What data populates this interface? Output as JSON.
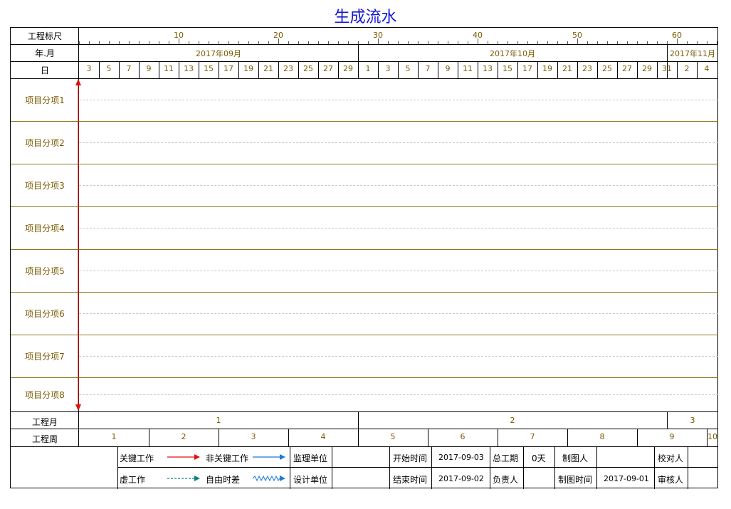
{
  "title": "生成流水",
  "header": {
    "scale_label": "工程标尺",
    "month_label": "年.月",
    "day_label": "日",
    "scale_ticks": [
      "10",
      "20",
      "30",
      "40",
      "50",
      "60"
    ],
    "months": [
      "2017年09月",
      "2017年10月",
      "2017年11月"
    ],
    "days": [
      "3",
      "5",
      "7",
      "9",
      "11",
      "13",
      "15",
      "17",
      "19",
      "21",
      "23",
      "25",
      "27",
      "29",
      "1",
      "3",
      "5",
      "7",
      "9",
      "11",
      "13",
      "15",
      "17",
      "19",
      "21",
      "23",
      "25",
      "27",
      "29",
      "31",
      "2",
      "4"
    ]
  },
  "rows": [
    "项目分项1",
    "项目分项2",
    "项目分项3",
    "项目分项4",
    "项目分项5",
    "项目分项6",
    "项目分项7",
    "项目分项8"
  ],
  "bottom": {
    "project_month_label": "工程月",
    "project_months": [
      "1",
      "2",
      "3"
    ],
    "project_week_label": "工程周",
    "project_weeks": [
      "1",
      "2",
      "3",
      "4",
      "5",
      "6",
      "7",
      "8",
      "9",
      "10"
    ]
  },
  "legend": {
    "critical": "关键工作",
    "noncritical": "非关键工作",
    "dummy": "虚工作",
    "free_float": "自由时差"
  },
  "info": {
    "supervisor_label": "监理单位",
    "supervisor_value": "",
    "designer_label": "设计单位",
    "designer_value": "",
    "start_label": "开始时间",
    "start_value": "2017-09-03",
    "end_label": "结束时间",
    "end_value": "2017-09-02",
    "duration_label": "总工期",
    "duration_value": "0天",
    "owner_label": "负责人",
    "owner_value": "",
    "drafter_label": "制图人",
    "drafter_value": "",
    "draw_time_label": "制图时间",
    "draw_time_value": "2017-09-01",
    "checker_label": "校对人",
    "checker_value": "",
    "reviewer_label": "审核人",
    "reviewer_value": ""
  },
  "colors": {
    "title": "#1515d6",
    "critical": "#e01010",
    "noncritical": "#1a7ad8",
    "dummy": "#108080",
    "free_float": "#1a7ad8",
    "label_text": "#7a5a00"
  }
}
